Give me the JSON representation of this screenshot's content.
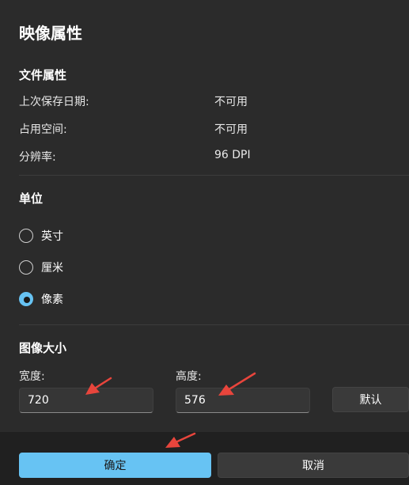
{
  "dialog": {
    "title": "映像属性"
  },
  "file_props": {
    "heading": "文件属性",
    "rows": [
      {
        "label": "上次保存日期:",
        "value": "不可用"
      },
      {
        "label": "占用空间:",
        "value": "不可用"
      },
      {
        "label": "分辨率:",
        "value": "96 DPI"
      }
    ]
  },
  "units": {
    "heading": "单位",
    "options": [
      {
        "label": "英寸",
        "checked": false
      },
      {
        "label": "厘米",
        "checked": false
      },
      {
        "label": "像素",
        "checked": true
      }
    ]
  },
  "image_size": {
    "heading": "图像大小",
    "width_label": "宽度:",
    "width_value": "720",
    "height_label": "高度:",
    "height_value": "576",
    "default_label": "默认"
  },
  "footer": {
    "ok_label": "确定",
    "cancel_label": "取消"
  },
  "colors": {
    "accent": "#67c3f3",
    "annotation_arrow": "#e8453c"
  }
}
